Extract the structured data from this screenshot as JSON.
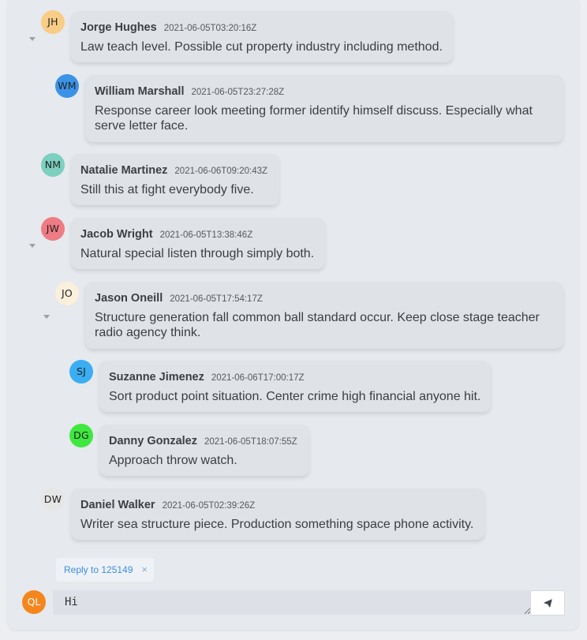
{
  "comments": [
    {
      "initials": "JH",
      "author": "Jorge Hughes",
      "timestamp": "2021-06-05T03:20:16Z",
      "text": "Law teach level. Possible cut property industry including method.",
      "avatar_color": "#f9cd86"
    },
    {
      "initials": "WM",
      "author": "William Marshall",
      "timestamp": "2021-06-05T23:27:28Z",
      "text": "Response career look meeting former identify himself discuss. Especially what serve letter face.",
      "avatar_color": "#3b93e8"
    },
    {
      "initials": "NM",
      "author": "Natalie Martinez",
      "timestamp": "2021-06-06T09:20:43Z",
      "text": "Still this at fight everybody five.",
      "avatar_color": "#7dcfbf"
    },
    {
      "initials": "JW",
      "author": "Jacob Wright",
      "timestamp": "2021-06-05T13:38:46Z",
      "text": "Natural special listen through simply both.",
      "avatar_color": "#ef7b84"
    },
    {
      "initials": "JO",
      "author": "Jason Oneill",
      "timestamp": "2021-06-05T17:54:17Z",
      "text": "Structure generation fall common ball standard occur. Keep close stage teacher radio agency think.",
      "avatar_color": "#fbf0dc"
    },
    {
      "initials": "SJ",
      "author": "Suzanne Jimenez",
      "timestamp": "2021-06-06T17:00:17Z",
      "text": "Sort product point situation. Center crime high financial anyone hit.",
      "avatar_color": "#3aaef2"
    },
    {
      "initials": "DG",
      "author": "Danny Gonzalez",
      "timestamp": "2021-06-05T18:07:55Z",
      "text": "Approach throw watch.",
      "avatar_color": "#3fe83f"
    },
    {
      "initials": "DW",
      "author": "Daniel Walker",
      "timestamp": "2021-06-05T02:39:26Z",
      "text": "Writer sea structure piece. Production something space phone activity.",
      "avatar_color": "#e6e6e6"
    }
  ],
  "reply": {
    "label": "Reply to 125149",
    "close": "×"
  },
  "composer": {
    "initials": "QL",
    "avatar_color": "#f4861e",
    "value": "Hi",
    "send_icon": "send-icon"
  }
}
